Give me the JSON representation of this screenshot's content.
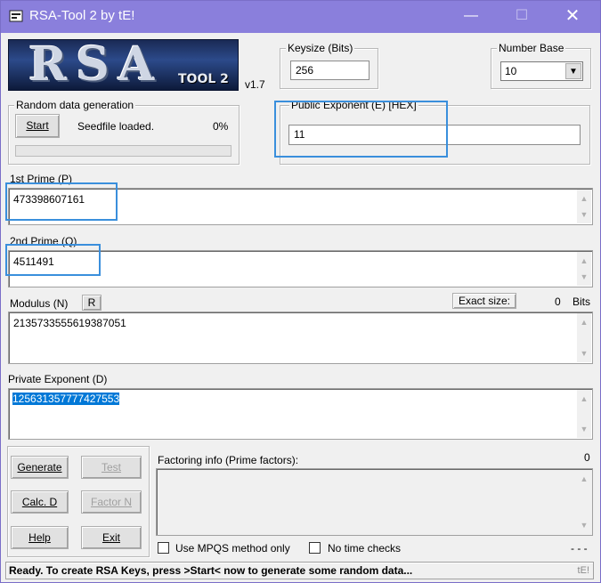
{
  "window": {
    "title": "RSA-Tool 2 by tE!",
    "min_glyph": "—",
    "max_glyph": "☐",
    "close_glyph": "✕",
    "icon": "rsa-tool-app-icon",
    "title_bar_color": "#8a7fdc"
  },
  "logo": {
    "main_text": "RSA",
    "sub_text": "TOOL 2",
    "version": "v1.7"
  },
  "keysize": {
    "label": "Keysize (Bits)",
    "value": "256"
  },
  "number_base": {
    "label": "Number Base",
    "value": "10",
    "arrow": "▼"
  },
  "random": {
    "label": "Random data generation",
    "start_button": "Start",
    "status": "Seedfile loaded.",
    "percent": "0%",
    "progress_fraction": 0
  },
  "public_exponent": {
    "label": "Public Exponent (E) [HEX]",
    "value": "11"
  },
  "prime_p": {
    "label": "1st Prime (P)",
    "value": "473398607161"
  },
  "prime_q": {
    "label": "2nd Prime (Q)",
    "value": "4511491"
  },
  "modulus": {
    "label": "Modulus (N)",
    "r_button": "R",
    "exact_size_label": "Exact size:",
    "size_value": "0",
    "size_unit": "Bits",
    "value": "2135733555619387051"
  },
  "private_exponent": {
    "label": "Private Exponent (D)",
    "value": "125631357777427553"
  },
  "buttons": {
    "generate": "Generate",
    "test": "Test",
    "calc_d": "Calc. D",
    "factor_n": "Factor N",
    "help": "Help",
    "exit": "Exit"
  },
  "factoring": {
    "label": "Factoring info (Prime factors):",
    "count": "0"
  },
  "options": {
    "mpqs": "Use MPQS method only",
    "no_time": "No time checks",
    "dashes": "- - -"
  },
  "status": {
    "message": "Ready. To create RSA Keys, press >Start< now to generate some random data...",
    "credit": "tE!"
  },
  "colors": {
    "highlight_box": "#3a8fdc",
    "selection": "#0078d7"
  }
}
